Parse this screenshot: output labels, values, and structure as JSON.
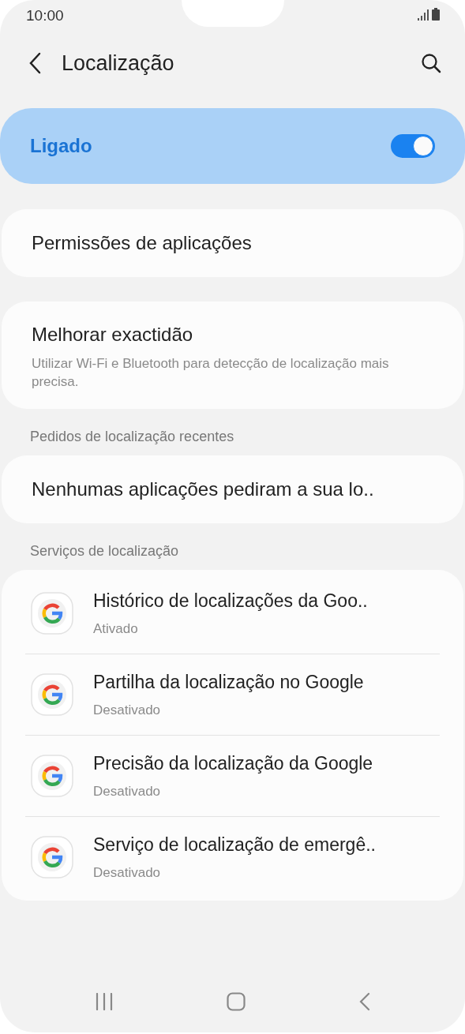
{
  "status_bar": {
    "time": "10:00"
  },
  "header": {
    "title": "Localização"
  },
  "master_switch": {
    "label": "Ligado",
    "on": true
  },
  "cards": [
    {
      "title": "Permissões de aplicações"
    },
    {
      "title": "Melhorar exactidão",
      "subtitle": "Utilizar Wi-Fi e Bluetooth para detecção de localização mais precisa."
    }
  ],
  "recent_requests": {
    "heading": "Pedidos de localização recentes",
    "text": "Nenhumas aplicações pediram a sua lo.."
  },
  "services": {
    "heading": "Serviços de localização",
    "items": [
      {
        "title": "Histórico de localizações da Goo..",
        "status": "Ativado"
      },
      {
        "title": "Partilha da localização no Google",
        "status": "Desativado"
      },
      {
        "title": "Precisão da localização da Google",
        "status": "Desativado"
      },
      {
        "title": "Serviço de localização de emergê..",
        "status": "Desativado"
      }
    ]
  }
}
